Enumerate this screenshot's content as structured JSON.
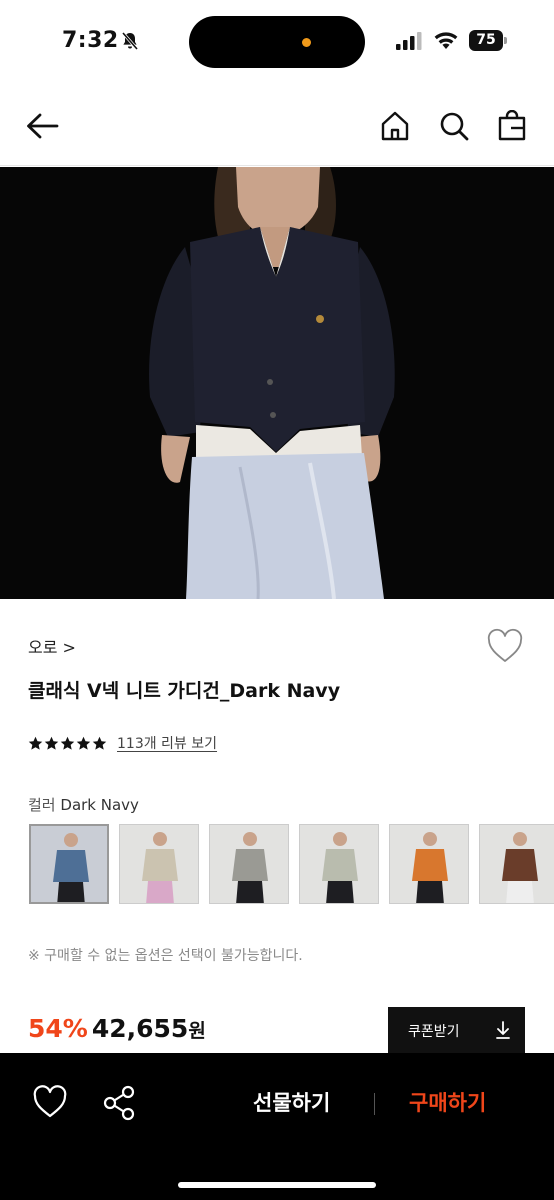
{
  "status_bar": {
    "time": "7:32",
    "battery": "75"
  },
  "nav": {
    "back_icon": "arrow-left-icon",
    "home_icon": "home-icon",
    "search_icon": "search-icon",
    "bag_icon": "shopping-bag-icon"
  },
  "product": {
    "brand": "오로 >",
    "title": "클래식 V넥 니트 가디건_Dark Navy",
    "rating_stars": 5,
    "review_link": "113개 리뷰 보기",
    "color_label": "컬러",
    "color_value": "Dark Navy",
    "notice": "※ 구매할 수 없는 옵션은 선택이 불가능합니다.",
    "discount": "54%",
    "price": "42,655",
    "price_unit": "원",
    "coupon_label": "쿠폰받기"
  },
  "swatches": [
    {
      "color": "#4e6f96"
    },
    {
      "color": "#cbc3b0"
    },
    {
      "color": "#9a9a94"
    },
    {
      "color": "#b9bcae"
    },
    {
      "color": "#d8772e"
    },
    {
      "color": "#6a3d2a"
    }
  ],
  "bottom_bar": {
    "gift_label": "선물하기",
    "buy_label": "구매하기"
  },
  "colors": {
    "accent": "#f0461a",
    "dark": "#111111"
  }
}
